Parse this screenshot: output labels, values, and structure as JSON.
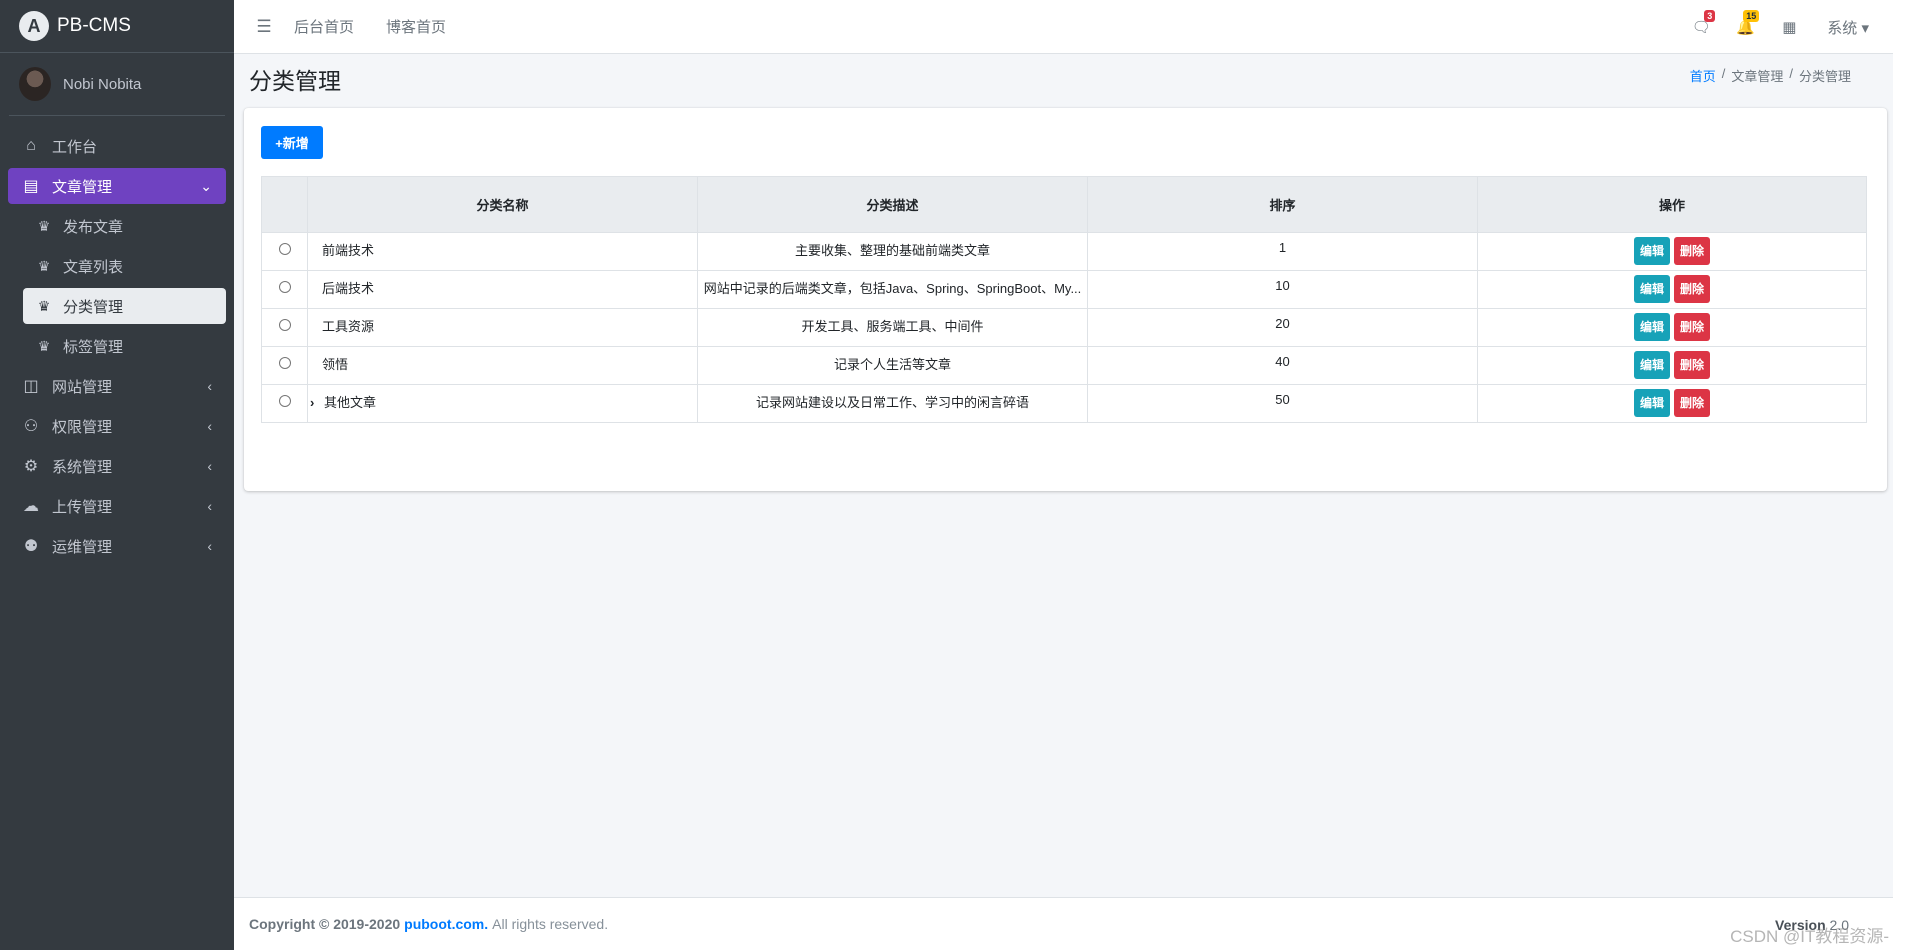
{
  "brand": {
    "name": "PB-CMS",
    "logo_icon": "logo-icon"
  },
  "user": {
    "name": "Nobi Nobita"
  },
  "sidebar": {
    "items": [
      {
        "label": "工作台",
        "icon": "home-icon"
      },
      {
        "label": "文章管理",
        "icon": "newspaper-icon",
        "active": true
      },
      {
        "label": "网站管理",
        "icon": "columns-icon"
      },
      {
        "label": "权限管理",
        "icon": "user-cog-icon"
      },
      {
        "label": "系统管理",
        "icon": "gear-icon"
      },
      {
        "label": "上传管理",
        "icon": "cloud-upload-icon"
      },
      {
        "label": "运维管理",
        "icon": "people-icon"
      }
    ],
    "subitems": [
      {
        "label": "发布文章",
        "icon": "crown-icon"
      },
      {
        "label": "文章列表",
        "icon": "crown-icon"
      },
      {
        "label": "分类管理",
        "icon": "crown-icon",
        "current": true
      },
      {
        "label": "标签管理",
        "icon": "crown-icon"
      }
    ]
  },
  "topbar": {
    "links": [
      "后台首页",
      "博客首页"
    ],
    "messages_count": "3",
    "notifications_count": "15",
    "system_label": "系统"
  },
  "page": {
    "title": "分类管理",
    "breadcrumb": [
      "首页",
      "文章管理",
      "分类管理"
    ]
  },
  "toolbar": {
    "add_label": "+新增"
  },
  "table": {
    "headers": [
      "分类名称",
      "分类描述",
      "排序",
      "操作"
    ],
    "rows": [
      {
        "name": "前端技术",
        "desc": "主要收集、整理的基础前端类文章",
        "sort": "1"
      },
      {
        "name": "后端技术",
        "desc": "网站中记录的后端类文章，包括Java、Spring、SpringBoot、My...",
        "sort": "10"
      },
      {
        "name": "工具资源",
        "desc": "开发工具、服务端工具、中间件",
        "sort": "20"
      },
      {
        "name": "领悟",
        "desc": "记录个人生活等文章",
        "sort": "40"
      },
      {
        "name": "其他文章",
        "desc": "记录网站建设以及日常工作、学习中的闲言碎语",
        "sort": "50",
        "expandable": true
      }
    ],
    "edit_label": "编辑",
    "delete_label": "删除"
  },
  "footer": {
    "copyright": "Copyright © 2019-2020",
    "site": "puboot.com.",
    "rights": "All rights reserved.",
    "version_label": "Version",
    "version": "2.0"
  },
  "watermark": "CSDN @IT教程资源-",
  "colors": {
    "sidebar": "#343a40",
    "accent": "#6f42c1",
    "primary": "#007bff",
    "info": "#17a2b8",
    "danger": "#dc3545"
  }
}
